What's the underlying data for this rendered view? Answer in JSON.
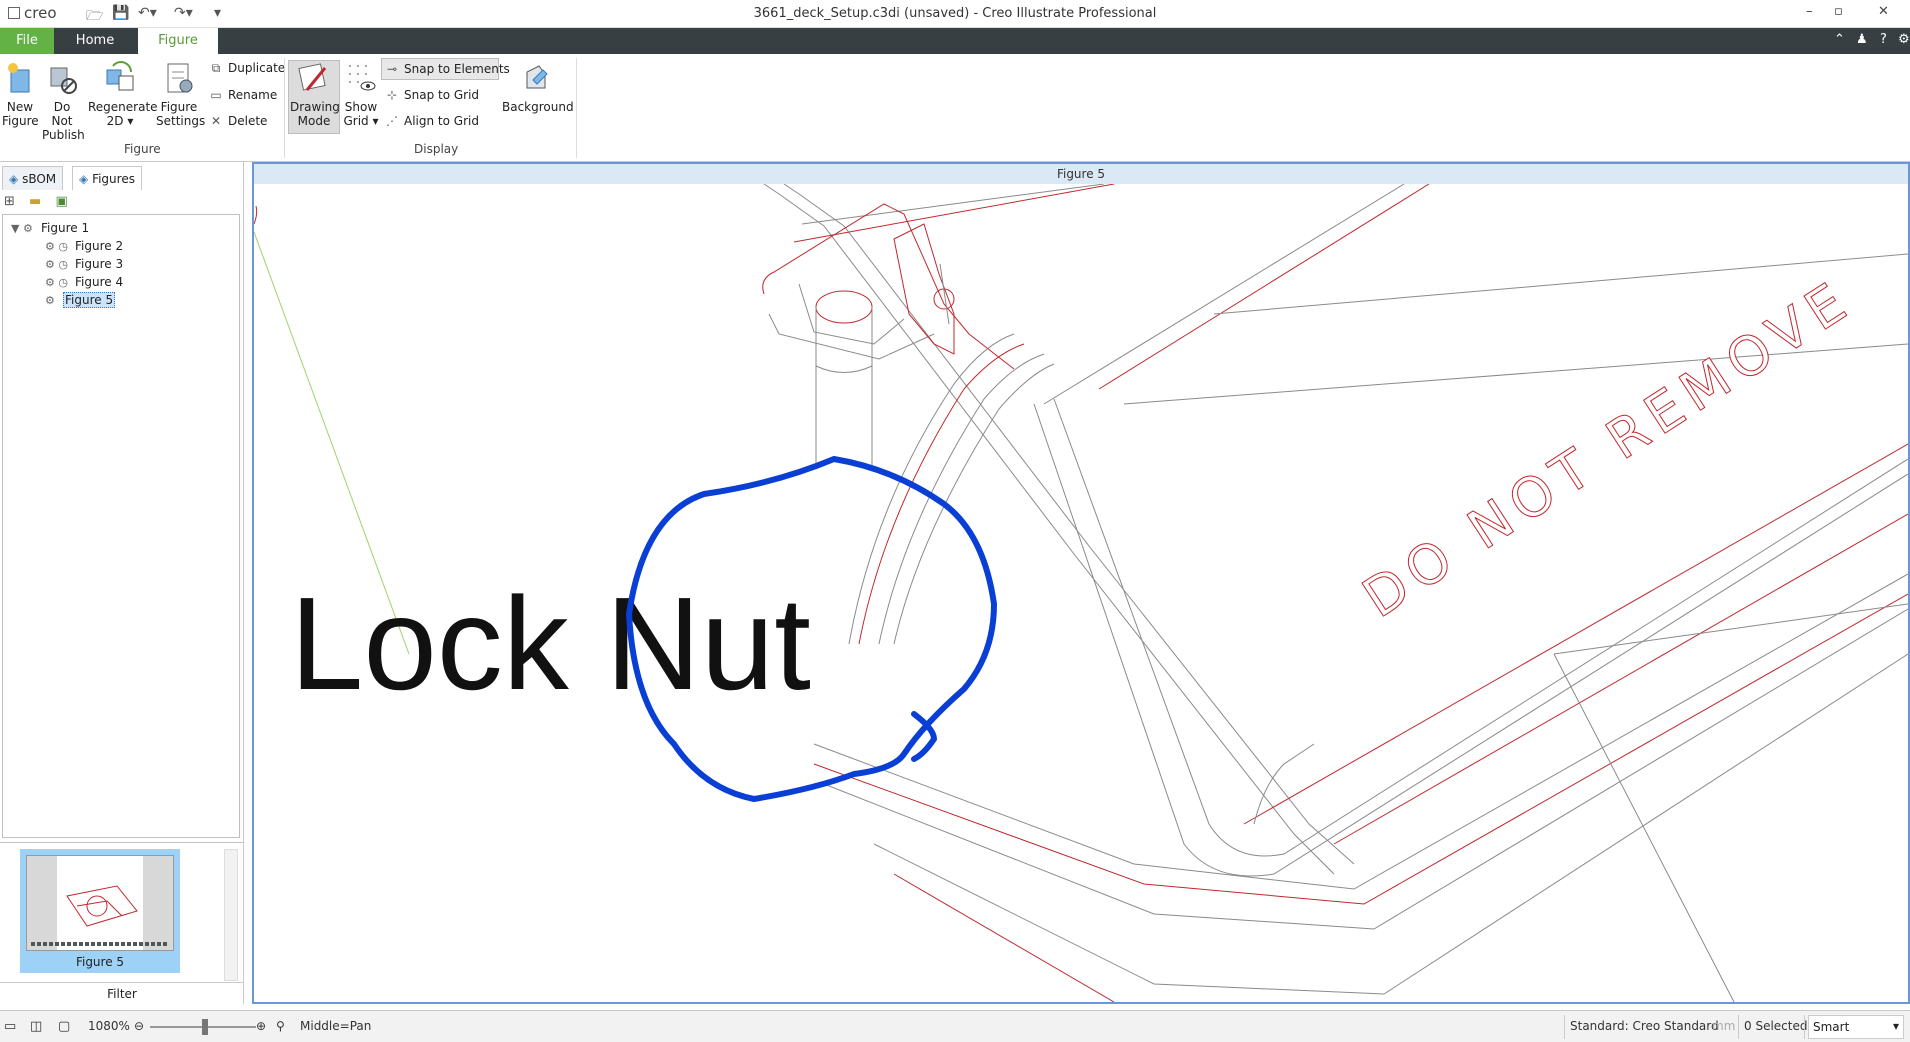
{
  "app": {
    "logo_text": "creo",
    "window_title": "3661_deck_Setup.c3di (unsaved) - Creo Illustrate Professional"
  },
  "tabs": {
    "file": "File",
    "home": "Home",
    "figure": "Figure"
  },
  "ribbon": {
    "figure_group": {
      "label": "Figure",
      "new_figure": "New\nFigure",
      "do_not_publish": "Do Not\nPublish",
      "regenerate_2d": "Regenerate\n2D ▾",
      "figure_settings": "Figure\nSettings",
      "duplicate": "Duplicate",
      "rename": "Rename",
      "delete": "Delete"
    },
    "display_group": {
      "label": "Display",
      "drawing_mode": "Drawing\nMode",
      "show_grid": "Show\nGrid ▾",
      "snap_to_elements": "Snap to Elements",
      "snap_to_grid": "Snap to Grid",
      "align_to_grid": "Align to Grid",
      "background": "Background"
    }
  },
  "left_panel": {
    "tabs": [
      "sBOM",
      "Figures"
    ],
    "active_tab": "Figures",
    "tree": [
      {
        "label": "Figure 1"
      },
      {
        "label": "Figure 2"
      },
      {
        "label": "Figure 3"
      },
      {
        "label": "Figure 4"
      },
      {
        "label": "Figure 5",
        "selected": true
      }
    ],
    "thumbnail_label": "Figure 5",
    "filter_label": "Filter"
  },
  "canvas": {
    "header": "Figure 5",
    "annotation_text": "Lock Nut",
    "engraved_text": "DO NOT REMOVE",
    "annotation_stroke_color": "#0a3fd6",
    "edge_color_red": "#c0282e",
    "edge_color_gray": "#8a8a8a"
  },
  "status": {
    "zoom": "1080%",
    "mouse_hint": "Middle=Pan",
    "standard": "Standard: Creo Standard",
    "units": "mm",
    "selected": "0 Selected",
    "selection_mode": "Smart"
  }
}
